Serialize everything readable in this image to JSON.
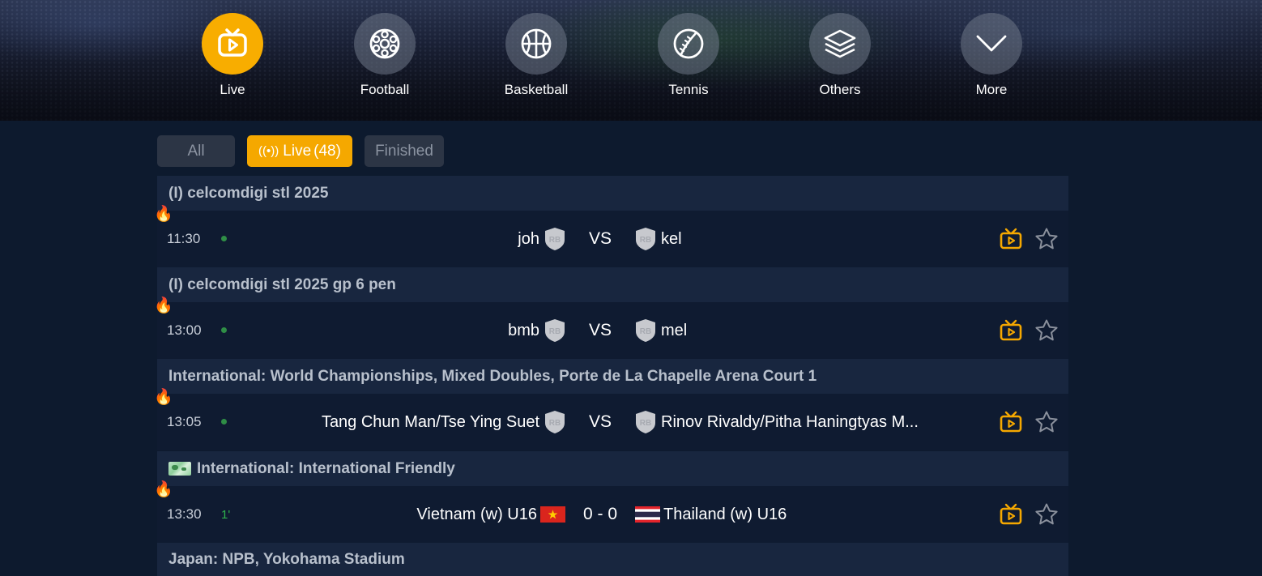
{
  "sports_nav": [
    {
      "label": "Live",
      "icon": "live-tv-icon",
      "active": true
    },
    {
      "label": "Football",
      "icon": "football-icon",
      "active": false
    },
    {
      "label": "Basketball",
      "icon": "basketball-icon",
      "active": false
    },
    {
      "label": "Tennis",
      "icon": "tennis-ball-icon",
      "active": false
    },
    {
      "label": "Others",
      "icon": "layers-icon",
      "active": false
    },
    {
      "label": "More",
      "icon": "chevron-down-icon",
      "active": false
    }
  ],
  "filter_tabs": {
    "all": "All",
    "live_label": "Live",
    "live_count": "(48)",
    "finished": "Finished",
    "active": "live"
  },
  "leagues": [
    {
      "name": "(I) celcomdigi stl 2025",
      "flag_icon": null,
      "match": {
        "time": "11:30",
        "status": "dot",
        "home": "joh",
        "away": "kel",
        "center": "VS",
        "home_badge": "RB",
        "away_badge": "RB",
        "hot": true
      }
    },
    {
      "name": "(I) celcomdigi stl 2025 gp 6 pen",
      "flag_icon": null,
      "match": {
        "time": "13:00",
        "status": "dot",
        "home": "bmb",
        "away": "mel",
        "center": "VS",
        "home_badge": "RB",
        "away_badge": "RB",
        "hot": true
      }
    },
    {
      "name": "International: World Championships, Mixed Doubles, Porte de La Chapelle Arena Court 1",
      "flag_icon": null,
      "match": {
        "time": "13:05",
        "status": "dot",
        "home": "Tang Chun Man/Tse Ying Suet",
        "away": "Rinov Rivaldy/Pitha Haningtyas M...",
        "center": "VS",
        "home_badge": "RB",
        "away_badge": "RB",
        "hot": true
      }
    },
    {
      "name": "International: International Friendly",
      "flag_icon": "world-map-flag-icon",
      "match": {
        "time": "13:30",
        "status": "1'",
        "home": "Vietnam (w) U16",
        "away": "Thailand (w) U16",
        "center": "0 - 0",
        "home_flag": "vietnam-flag-icon",
        "away_flag": "thailand-flag-icon",
        "hot": true
      }
    },
    {
      "name": "Japan: NPB, Yokohama Stadium",
      "flag_icon": null
    }
  ],
  "colors": {
    "accent": "#f5a800",
    "page_bg": "#0d1a2e",
    "league_bg": "#18263f",
    "row_bg": "#0f1b31",
    "live_green": "#2fb24c"
  }
}
